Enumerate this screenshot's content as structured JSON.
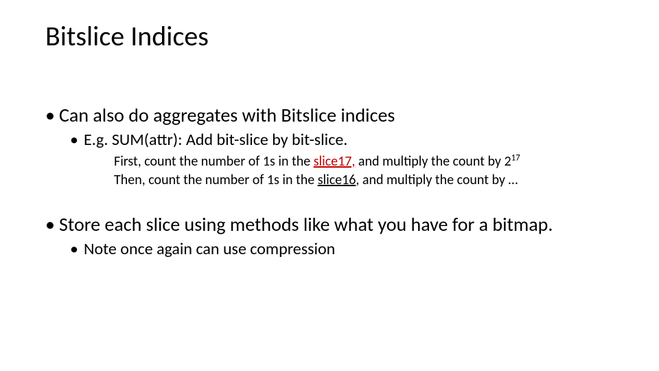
{
  "title": "Bitslice Indices",
  "b1": "Can also do aggregates with Bitslice indices",
  "b1a": "E.g. SUM(attr): Add bit-slice by bit-slice.",
  "b1a_l1_pre": "First, count the number of 1s in the ",
  "b1a_l1_red": "slice17,",
  "b1a_l1_mid": " and multiply the count by 2",
  "b1a_l1_sup": "17",
  "b1a_l2_pre": "Then, count the number of 1s in the ",
  "b1a_l2_u": "slice16",
  "b1a_l2_post": ", and multiply the count by …",
  "b2": "Store each slice using methods like what you have for a bitmap.",
  "b2a": "Note once again can use compression"
}
